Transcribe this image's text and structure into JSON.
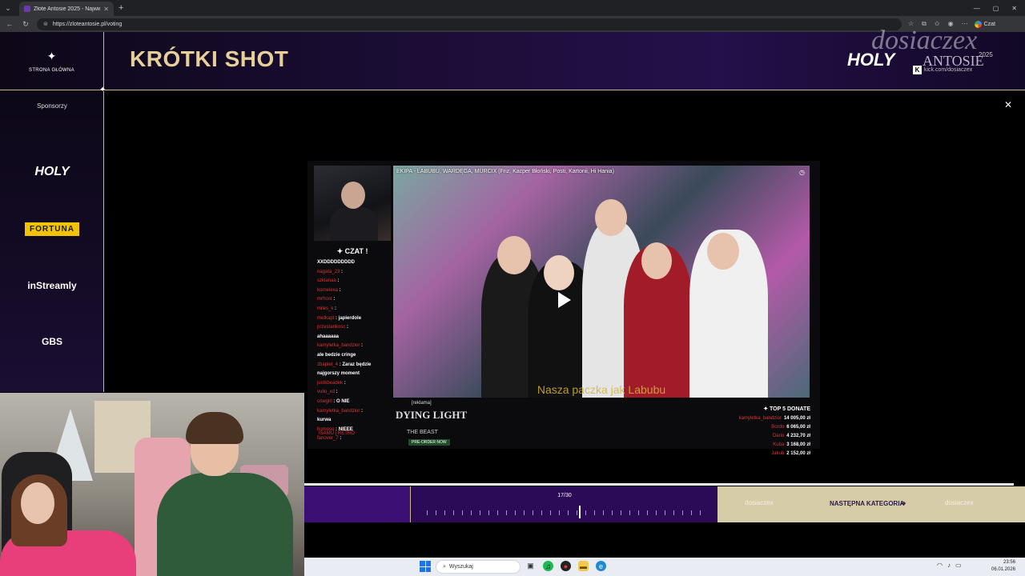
{
  "browser": {
    "tab_title": "Złote Antosie 2025 - Największy P",
    "url": "https://zloteantosie.pl/voting",
    "czat_label": "Czat"
  },
  "header": {
    "home_label": "STRONA GŁÓWNA",
    "title": "KRÓTKI SHOT",
    "brand_holy": "HOLY",
    "brand_antosie": "ANTOSIE",
    "brand_year": "2025",
    "watermark": "dosiaczex",
    "kick_handle": "kick.com/dosiaczex"
  },
  "sidebar": {
    "label": "Sponsorzy",
    "sponsors": [
      "HOLY",
      "FORTUNA",
      "inStreamly",
      "GBS"
    ]
  },
  "video": {
    "title": "EKIPA - LABUBU, WARDĘGA, MURCIX (Friz, Kacper Błoński, Posti, Kartonii, Hi Hania)",
    "subtitle": "Nasza paczka jak Labubu",
    "chat_title": "CZAT",
    "chat": [
      {
        "user": "",
        "msg": "XXDDDDDDDDD"
      },
      {
        "user": "nagata_23",
        "msg": ""
      },
      {
        "user": "szklanaa",
        "msg": ""
      },
      {
        "user": "kornelexa",
        "msg": ""
      },
      {
        "user": "mrfrost",
        "msg": ""
      },
      {
        "user": "miles_k",
        "msg": ""
      },
      {
        "user": "metkapt",
        "msg": "japierdole"
      },
      {
        "user": "przestankosc",
        "msg": ""
      },
      {
        "user": "",
        "msg": "ahaaaaaa"
      },
      {
        "user": "kamyletka_bandzior",
        "msg": ""
      },
      {
        "user": "",
        "msg": "ale bedzie cringe"
      },
      {
        "user": "zbaplet_4",
        "msg": "Zaraz będzie"
      },
      {
        "user": "",
        "msg": "najgorszy moment"
      },
      {
        "user": "justkbeadek",
        "msg": ""
      },
      {
        "user": "vulio_xd",
        "msg": ""
      },
      {
        "user": "cowgirl",
        "msg": "O NIE"
      },
      {
        "user": "kamyletka_bandzior",
        "msg": ""
      },
      {
        "user": "",
        "msg": "kurwa"
      },
      {
        "user": "homoso",
        "msg": "NIEEE"
      },
      {
        "user": "fanover_7",
        "msg": ""
      }
    ],
    "ad_tag": "[reklama]",
    "ad_title_1": "DYING LIGHT",
    "ad_title_2": "THE BEAST",
    "ad_badge": "PRE-ORDER NOW",
    "bottom_brand": "ISAMU | RETRO",
    "donate_title": "TOP 5 DONATE",
    "donates": [
      {
        "user": "kamyletka_bandzior",
        "amount": "14 005,00 zł"
      },
      {
        "user": "Bordo",
        "amount": "6 065,00 zł"
      },
      {
        "user": "Dario",
        "amount": "4 232,70 zł"
      },
      {
        "user": "Kuba",
        "amount": "3 168,00 zł"
      },
      {
        "user": "Jakub",
        "amount": "2 152,00 zł"
      }
    ]
  },
  "progress_percent": 100,
  "navigation": {
    "counter": "17/30",
    "current": 17,
    "total": 30,
    "next_label": "NASTĘPNA KATEGORIA",
    "watermark_left": "dosiaczex",
    "watermark_right": "dosiaczex"
  },
  "taskbar": {
    "search_placeholder": "Wyszukaj",
    "time": "23:56",
    "date": "06.01.2026"
  },
  "colors": {
    "gold": "#e6cf9a",
    "purple": "#3b0f74",
    "fortuna": "#f2c300"
  }
}
